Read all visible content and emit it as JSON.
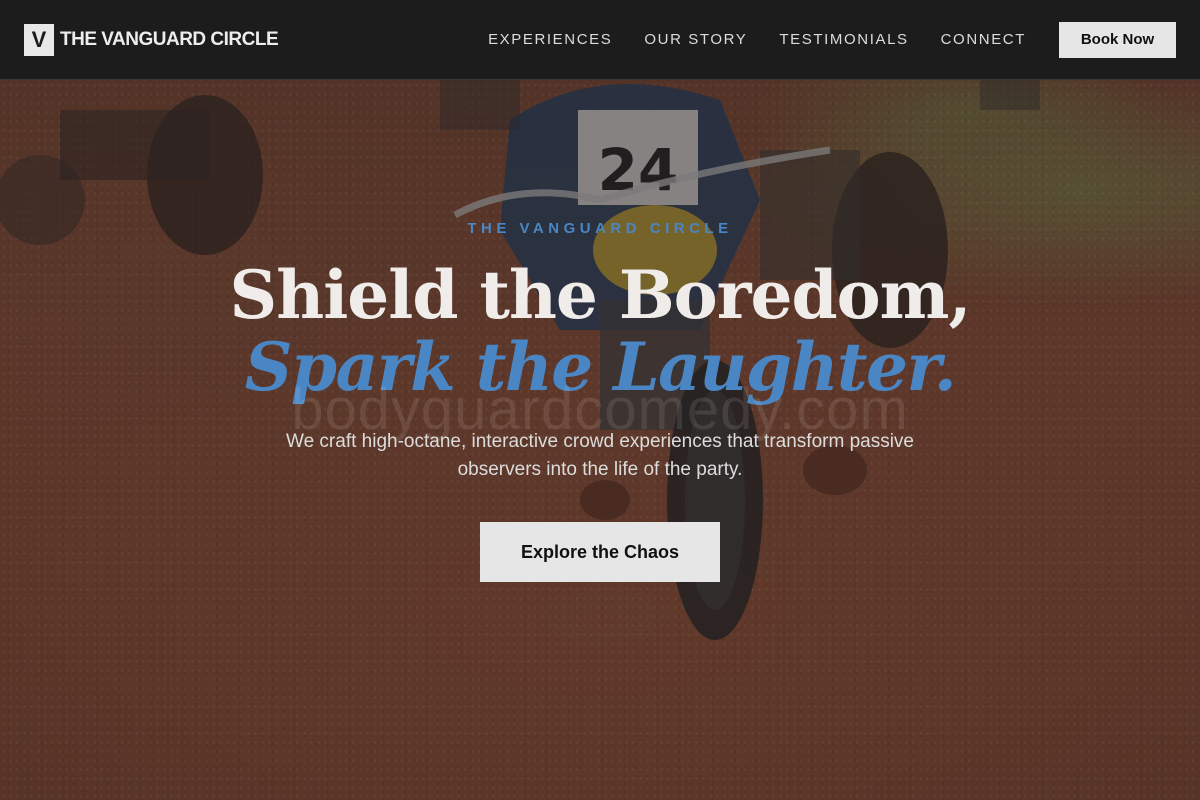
{
  "navbar": {
    "logo_letter": "V",
    "brand_name": "THE VANGUARD CIRCLE",
    "links": [
      "EXPERIENCES",
      "OUR STORY",
      "TESTIMONIALS",
      "CONNECT"
    ],
    "book_label": "Book Now"
  },
  "hero": {
    "eyebrow": "THE VANGUARD CIRCLE",
    "headline_line1": "Shield the Boredom,",
    "headline_line2": "Spark the Laughter.",
    "watermark": "bodyguardcomedy.com",
    "subtext": "We craft high-octane, interactive crowd experiences that transform passive observers into the life of the party.",
    "cta_label": "Explore the Chaos",
    "race_number": "24"
  },
  "colors": {
    "accent": "#4a86c4",
    "navbar_bg": "#1d1c1c",
    "button_bg": "#e6e6e6",
    "dirt": "#83472f"
  }
}
